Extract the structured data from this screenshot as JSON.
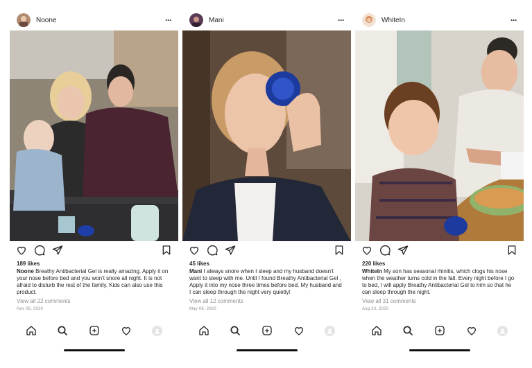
{
  "posts": [
    {
      "username": "Noone",
      "likes": "189 likes",
      "caption_user": "Noone",
      "caption_text": " Breathy Antibacterial Gel is really amazing. Apply it on your nose before bed and you won't snore all night. It is not afraid to disturb the rest of the family. Kids can also use this product.",
      "comments": "View all 22 comments",
      "date": "Nov 06, 2020",
      "colors": {
        "photo_bg": "#8a7b6a",
        "avatar": "#b08a70"
      }
    },
    {
      "username": "Mani",
      "likes": "45 likes",
      "caption_user": "Mani",
      "caption_text": " I always snore when I sleep and my husband doesn't want to sleep with me. Until I found Breathy Antibacterial Gel , Apply it into my nose three times before bed. My husband and I can sleep through the night very quietly!",
      "comments": "View all 12 comments",
      "date": "May 06, 2020",
      "colors": {
        "photo_bg": "#6b5848",
        "avatar": "#5a3a55"
      }
    },
    {
      "username": "WhiteIn",
      "likes": "220 likes",
      "caption_user": "WhiteIn",
      "caption_text": "    My son has seasonal rhinitis, which clogs his nose when the weather turns cold in the fall. Every night before I go to bed, I will apply Breathy Antibacterial Gel to him so that he can sleep through the night.",
      "comments": "View all 31 comments",
      "date": "Aug 23, 2020",
      "colors": {
        "photo_bg": "#c9c2b8",
        "avatar": "#d89060"
      }
    }
  ],
  "icons": {
    "like": "heart-icon",
    "comment": "comment-icon",
    "share": "send-icon",
    "save": "bookmark-icon",
    "tab_home": "home-icon",
    "tab_search": "search-icon",
    "tab_new": "add-post-icon",
    "tab_activity": "heart-icon",
    "tab_profile": "profile-icon"
  },
  "colors": {
    "text": "#262626",
    "muted": "#8e8e8e",
    "background": "#ffffff"
  }
}
